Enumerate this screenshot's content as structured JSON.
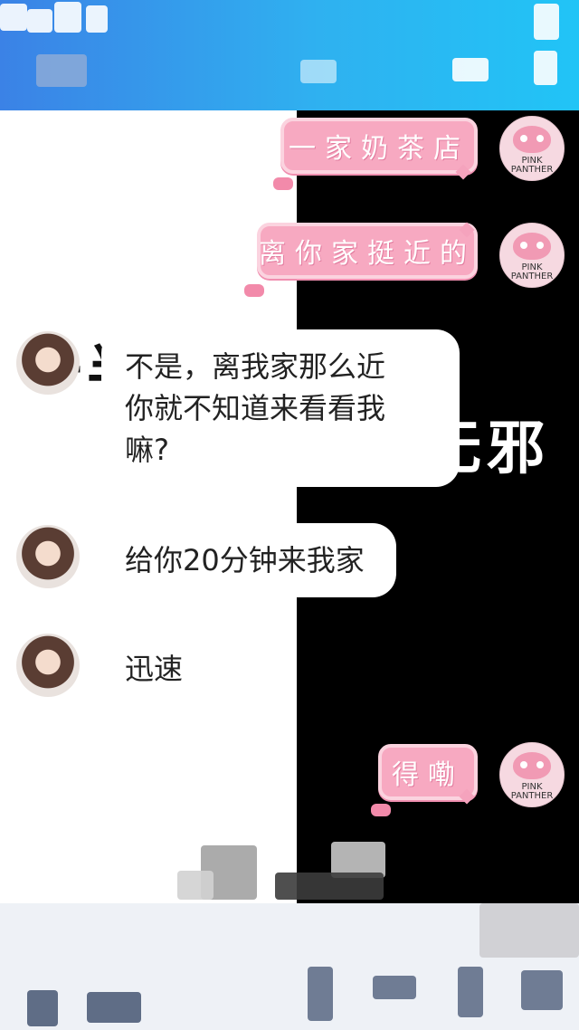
{
  "background": {
    "left_text": "一半天真",
    "right_text": "一半无邪"
  },
  "avatars": {
    "self_label": "PINK PANTHER"
  },
  "messages": [
    {
      "side": "right",
      "type": "sticker",
      "text": "一家奶茶店"
    },
    {
      "side": "right",
      "type": "sticker",
      "text": "离你家挺近的"
    },
    {
      "side": "left",
      "type": "text",
      "lines": [
        "不是，离我家那么近",
        "你就不知道来看看我",
        "嘛?"
      ]
    },
    {
      "side": "left",
      "type": "text",
      "lines": [
        "给你20分钟来我家"
      ]
    },
    {
      "side": "left",
      "type": "text",
      "lines": [
        "迅速"
      ]
    },
    {
      "side": "right",
      "type": "sticker",
      "text": "得嘞"
    }
  ],
  "colors": {
    "banner_start": "#3b82e6",
    "banner_end": "#21c4f6",
    "sticker_pink": "#f7a9c1",
    "right_bg": "#000000"
  }
}
